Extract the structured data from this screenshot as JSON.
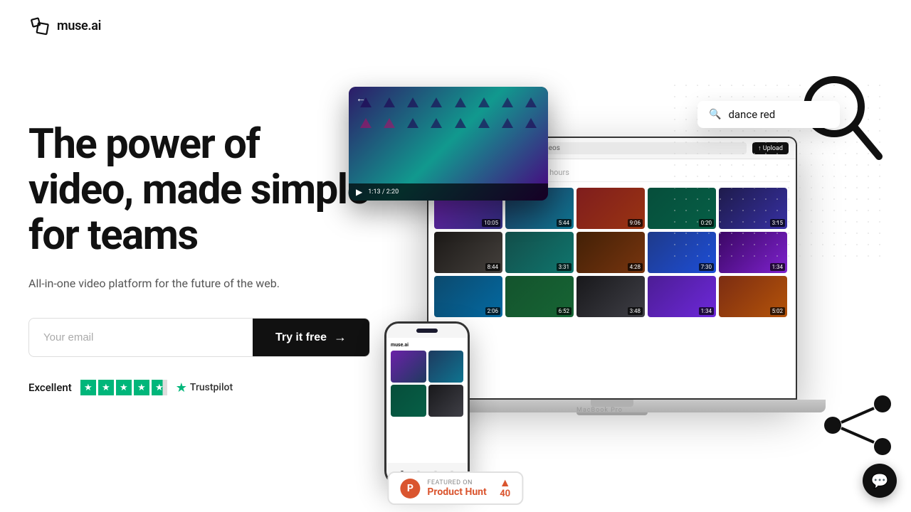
{
  "header": {
    "logo_text": "muse.ai"
  },
  "hero": {
    "headline": "The power of video, made simple for teams",
    "subtext": "All-in-one video platform for the future of the web.",
    "email_placeholder": "Your email",
    "cta_button": "Try it free",
    "trustpilot_label": "Excellent",
    "trustpilot_brand": "Trustpilot"
  },
  "search_overlay": {
    "query": "dance red"
  },
  "video_overlay": {
    "time": "1:13 / 2:20"
  },
  "product_hunt": {
    "featured_text": "FEATURED ON",
    "name": "Product Hunt",
    "count": "40"
  },
  "macbook_label": "MacBook Pro",
  "chat_widget": {
    "icon": "💬"
  }
}
